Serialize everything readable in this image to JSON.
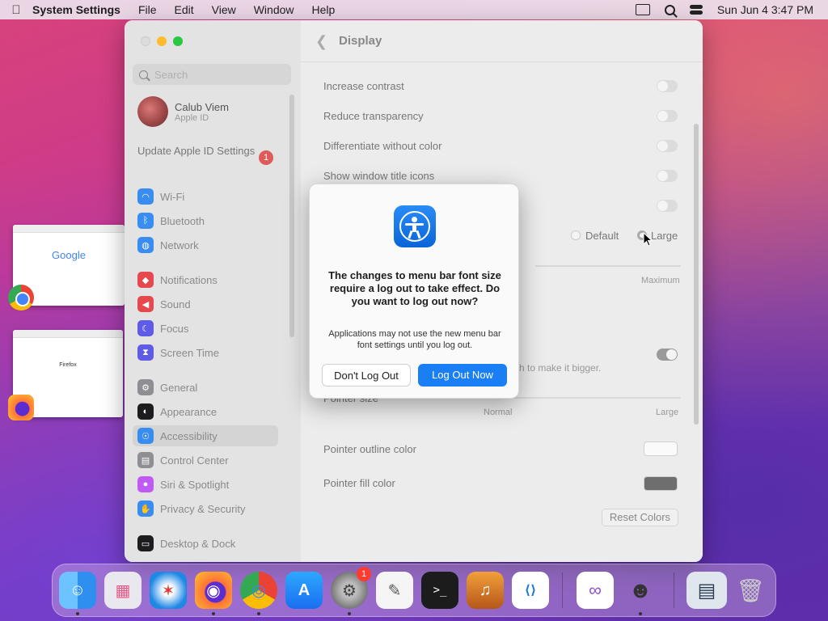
{
  "menubar": {
    "app_name": "System Settings",
    "menus": [
      "File",
      "Edit",
      "View",
      "Window",
      "Help"
    ],
    "datetime": "Sun Jun 4  3:47 PM"
  },
  "stage": {
    "chrome_thumb_text": "Google",
    "firefox_thumb_text": "Firefox"
  },
  "sidebar": {
    "search_placeholder": "Search",
    "account_name": "Calub Viem",
    "account_sub": "Apple ID",
    "update_label": "Update Apple ID Settings",
    "update_badge": "1",
    "items": [
      {
        "label": "Wi-Fi",
        "icon": "wifi-icon",
        "color": "#3a8df0"
      },
      {
        "label": "Bluetooth",
        "icon": "bluetooth-icon",
        "color": "#3a8df0"
      },
      {
        "label": "Network",
        "icon": "globe-icon",
        "color": "#3a8df0"
      },
      {
        "label": "Notifications",
        "icon": "bell-icon",
        "color": "#e5484d"
      },
      {
        "label": "Sound",
        "icon": "speaker-icon",
        "color": "#e5484d"
      },
      {
        "label": "Focus",
        "icon": "moon-icon",
        "color": "#5e5ce6"
      },
      {
        "label": "Screen Time",
        "icon": "hourglass-icon",
        "color": "#5e5ce6"
      },
      {
        "label": "General",
        "icon": "gear-icon",
        "color": "#8e8e93"
      },
      {
        "label": "Appearance",
        "icon": "appearance-icon",
        "color": "#1d1d1f"
      },
      {
        "label": "Accessibility",
        "icon": "accessibility-icon",
        "color": "#3a8df0"
      },
      {
        "label": "Control Center",
        "icon": "control-center-icon",
        "color": "#8e8e93"
      },
      {
        "label": "Siri & Spotlight",
        "icon": "siri-icon",
        "color": "#bf5af2"
      },
      {
        "label": "Privacy & Security",
        "icon": "hand-icon",
        "color": "#3a8df0"
      },
      {
        "label": "Desktop & Dock",
        "icon": "dock-icon",
        "color": "#1d1d1f"
      }
    ],
    "selected": "Accessibility"
  },
  "content": {
    "title": "Display",
    "rows": {
      "increase_contrast": "Increase contrast",
      "reduce_transparency": "Reduce transparency",
      "differentiate": "Differentiate without color",
      "window_title_icons": "Show window title icons"
    },
    "menu_font_default": "Default",
    "menu_font_large": "Large",
    "slider_max": "Maximum",
    "partial_hint": "h to make it bigger.",
    "pointer_size_label": "Pointer size",
    "pointer_size_normal": "Normal",
    "pointer_size_large": "Large",
    "pointer_outline_label": "Pointer outline color",
    "pointer_fill_label": "Pointer fill color",
    "pointer_outline_color": "#ffffff",
    "pointer_fill_color": "#6e6e6e",
    "reset_colors": "Reset Colors"
  },
  "dialog": {
    "title": "The changes to menu bar font size require a log out to take effect. Do you want to log out now?",
    "body": "Applications may not use the new menu bar font settings until you log out.",
    "cancel": "Don't Log Out",
    "confirm": "Log Out Now",
    "icon": "accessibility-icon",
    "accent": "#1a7ef5"
  },
  "dock": {
    "apps": [
      {
        "name": "finder-icon",
        "glyph": "☺",
        "color": "#2f8ff0"
      },
      {
        "name": "launchpad-icon",
        "glyph": "▦",
        "color": "#e8e8ee"
      },
      {
        "name": "safari-icon",
        "glyph": "✶",
        "color": "#1e88e5"
      },
      {
        "name": "firefox-icon",
        "glyph": "◉",
        "color": "#5b2ccf"
      },
      {
        "name": "chrome-icon",
        "glyph": "◎",
        "color": "#ffffff"
      },
      {
        "name": "app-store-icon",
        "glyph": "A",
        "color": "#1a86f0"
      },
      {
        "name": "system-settings-icon",
        "glyph": "⚙",
        "color": "#8e8e93"
      },
      {
        "name": "textedit-icon",
        "glyph": "✎",
        "color": "#f5f5f5"
      },
      {
        "name": "terminal-icon",
        "glyph": ">_",
        "color": "#1c1c1c"
      },
      {
        "name": "garageband-icon",
        "glyph": "♫",
        "color": "#e07b1a"
      },
      {
        "name": "vscode-icon",
        "glyph": "⟨⟩",
        "color": "#ffffff"
      },
      {
        "name": "visual-studio-icon",
        "glyph": "∞",
        "color": "#ffffff"
      },
      {
        "name": "character-app-icon",
        "glyph": "☻",
        "color": "#f0f0f0"
      },
      {
        "name": "window-preview-icon",
        "glyph": "▤",
        "color": "#dfe6ee"
      },
      {
        "name": "trash-icon",
        "glyph": "🗑",
        "color": "#e6e6e6"
      }
    ],
    "settings_badge": "1"
  }
}
